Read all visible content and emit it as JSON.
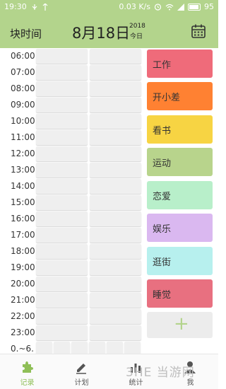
{
  "status_bar": {
    "time": "19:30",
    "speed": "0.03 K/s",
    "battery": "95"
  },
  "header": {
    "title": "块时间",
    "date": "8月18日",
    "year": "2018",
    "today": "今日",
    "calendar_icon": "calendar-icon"
  },
  "hours": [
    "06:00",
    "07:00",
    "08:00",
    "09:00",
    "10:00",
    "11:00",
    "12:00",
    "13:00",
    "14:00",
    "15:00",
    "16:00",
    "17:00",
    "18:00",
    "19:00",
    "20:00",
    "21:00",
    "22:00",
    "23:00",
    "0.~6."
  ],
  "categories": [
    {
      "label": "工作",
      "color": "#ef6b7a"
    },
    {
      "label": "开小差",
      "color": "#ff8132"
    },
    {
      "label": "看书",
      "color": "#f7d443"
    },
    {
      "label": "运动",
      "color": "#b8d48c"
    },
    {
      "label": "恋爱",
      "color": "#b8efca"
    },
    {
      "label": "娱乐",
      "color": "#dab8f0"
    },
    {
      "label": "逛街",
      "color": "#b7f0ee"
    },
    {
      "label": "睡觉",
      "color": "#e87080"
    }
  ],
  "add_category": {
    "label": "+",
    "color": "#b3d48c"
  },
  "nav": {
    "items": [
      {
        "label": "记录",
        "icon": "puzzle-icon",
        "active": true
      },
      {
        "label": "计划",
        "icon": "pencil-icon",
        "active": false
      },
      {
        "label": "统计",
        "icon": "stats-icon",
        "active": false
      },
      {
        "label": "我",
        "icon": "person-icon",
        "active": false
      }
    ]
  },
  "watermark": "3HE 当游网",
  "colors": {
    "accent": "#b3d48c",
    "active_nav": "#8fbf57",
    "slot": "#efefef"
  }
}
